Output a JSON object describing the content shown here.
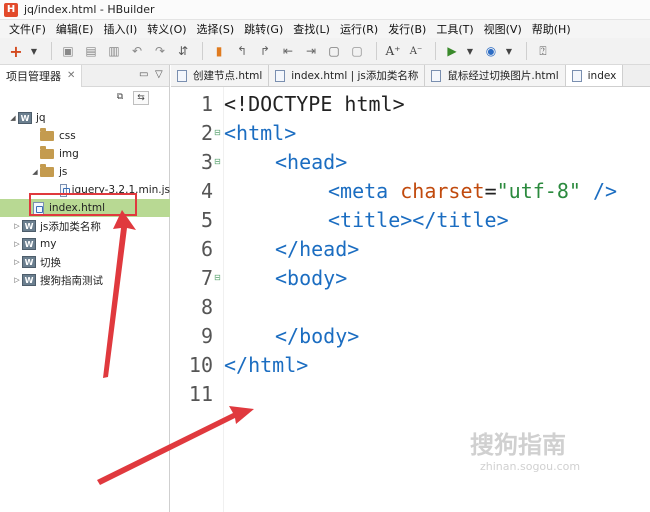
{
  "window": {
    "title": "jq/index.html  -  HBuilder",
    "logo": "H"
  },
  "menu": [
    "文件(F)",
    "编辑(E)",
    "插入(I)",
    "转义(O)",
    "选择(S)",
    "跳转(G)",
    "查找(L)",
    "运行(R)",
    "发行(B)",
    "工具(T)",
    "视图(V)",
    "帮助(H)"
  ],
  "toolbar": {
    "icons": [
      "new-icon",
      "save-icon",
      "save-all-icon",
      "save-as-icon",
      "undo-icon",
      "redo-icon",
      "format-icon",
      "bookmark-icon",
      "go-back-icon",
      "go-forward-icon",
      "jump-start-icon",
      "jump-end-icon",
      "comment-icon",
      "uncomment-icon",
      "font-increase-icon",
      "font-decrease-icon",
      "run-icon",
      "browser-icon",
      "help-icon"
    ]
  },
  "project_panel": {
    "title": "项目管理器",
    "tree": [
      {
        "label": "jq",
        "level": 0,
        "type": "project",
        "expanded": true
      },
      {
        "label": "css",
        "level": 1,
        "type": "folder"
      },
      {
        "label": "img",
        "level": 1,
        "type": "folder"
      },
      {
        "label": "js",
        "level": 1,
        "type": "folder",
        "expanded": true
      },
      {
        "label": "jquery-3.2.1.min.js",
        "level": 2,
        "type": "file"
      },
      {
        "label": "index.html",
        "level": 1,
        "type": "file",
        "selected": true
      },
      {
        "label": "js添加类名称",
        "level": 0,
        "type": "project"
      },
      {
        "label": "my",
        "level": 0,
        "type": "project"
      },
      {
        "label": "切换",
        "level": 0,
        "type": "project"
      },
      {
        "label": "搜狗指南测试",
        "level": 0,
        "type": "project"
      }
    ]
  },
  "editor_tabs": [
    "创建节点.html",
    "index.html | js添加类名称",
    "鼠标经过切换图片.html",
    "index"
  ],
  "editor": {
    "line_numbers": [
      "1",
      "2",
      "3",
      "4",
      "5",
      "6",
      "7",
      "8",
      "9",
      "10",
      "11"
    ],
    "lines": {
      "l1": "<!DOCTYPE html>",
      "l2": "<html>",
      "l3": "<head>",
      "l4_tag": "<meta",
      "l4_attr": "charset",
      "l4_eq": "=",
      "l4_str": "\"utf-8\"",
      "l4_end": "/>",
      "l5": "<title></title>",
      "l6": "</head>",
      "l7": "<body>",
      "l9": "</body>",
      "l10": "</html>"
    }
  },
  "watermark": {
    "logo": "搜狗指南",
    "url": "zhinan.sogou.com"
  },
  "colors": {
    "tag": "#1b6dc1",
    "attr": "#c14a0d",
    "string": "#2b8a3e",
    "selection": "#b8d993",
    "annotation": "#e0393e"
  }
}
